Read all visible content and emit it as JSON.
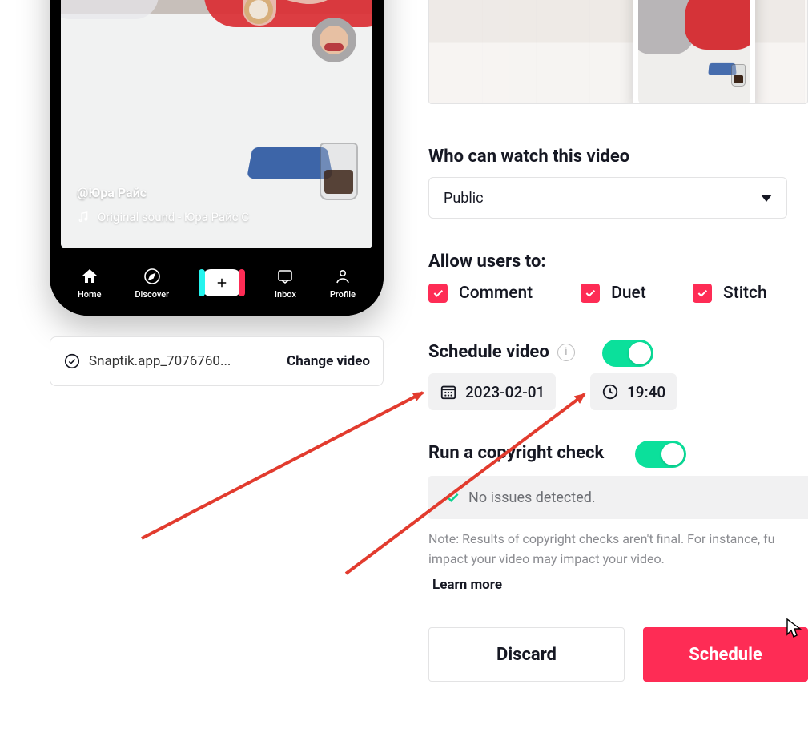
{
  "preview": {
    "user_tag": "@Юра Райс",
    "sound_label": "Original sound - Юра Райс С",
    "nav": {
      "home": "Home",
      "discover": "Discover",
      "inbox": "Inbox",
      "profile": "Profile"
    }
  },
  "file": {
    "name": "Snaptik.app_7076760...",
    "change_label": "Change video"
  },
  "visibility": {
    "title": "Who can watch this video",
    "value": "Public"
  },
  "permissions": {
    "title": "Allow users to:",
    "comment": "Comment",
    "duet": "Duet",
    "stitch": "Stitch"
  },
  "schedule": {
    "title": "Schedule video",
    "date": "2023-02-01",
    "time": "19:40"
  },
  "copyright": {
    "title": "Run a copyright check",
    "status": "No issues detected.",
    "note": "Note: Results of copyright checks aren't final. For instance, fu impact your video may impact your video.",
    "learn": "Learn more"
  },
  "actions": {
    "discard": "Discard",
    "schedule": "Schedule"
  }
}
